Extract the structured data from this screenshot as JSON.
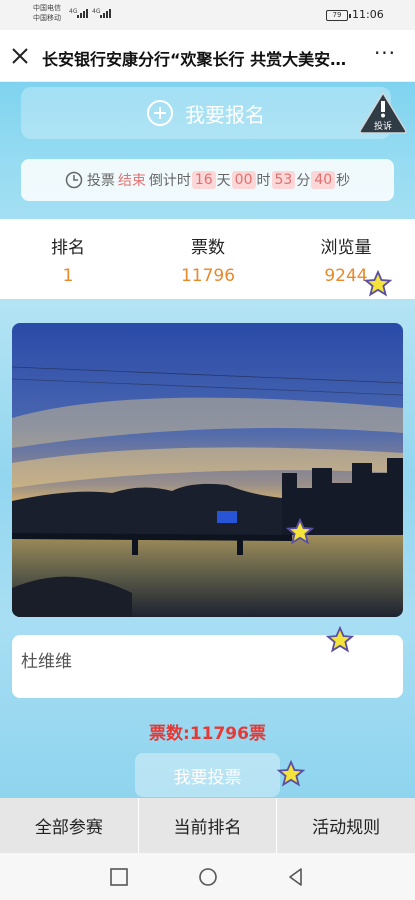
{
  "status_bar": {
    "carrier_1": "中国电信",
    "carrier_2": "中国移动",
    "network_1": "4G",
    "network_2": "4G",
    "battery": "79",
    "time": "11:06"
  },
  "title_bar": {
    "title": "长安银行安康分行“欢聚长行 共赏大美安康”摄影大赛"
  },
  "signup": {
    "label": "我要报名",
    "report_label": "投诉"
  },
  "countdown": {
    "prefix": "投票",
    "status": "结束",
    "middle": "倒计时",
    "days": "16",
    "days_unit": "天",
    "hours": "00",
    "hours_unit": "时",
    "minutes": "53",
    "minutes_unit": "分",
    "seconds": "40",
    "seconds_unit": "秒"
  },
  "stats": {
    "rank_label": "排名",
    "rank_value": "1",
    "votes_label": "票数",
    "votes_value": "11796",
    "views_label": "浏览量",
    "views_value": "9244"
  },
  "entry": {
    "name": "杜维维",
    "vote_count_text": "票数:11796票",
    "vote_button": "我要投票"
  },
  "bottom_nav": [
    {
      "label": "全部参赛"
    },
    {
      "label": "当前排名"
    },
    {
      "label": "活动规则"
    }
  ],
  "colors": {
    "accent_orange": "#e8892b",
    "vote_red": "#e53935",
    "background_blue": "#98dcf2"
  }
}
